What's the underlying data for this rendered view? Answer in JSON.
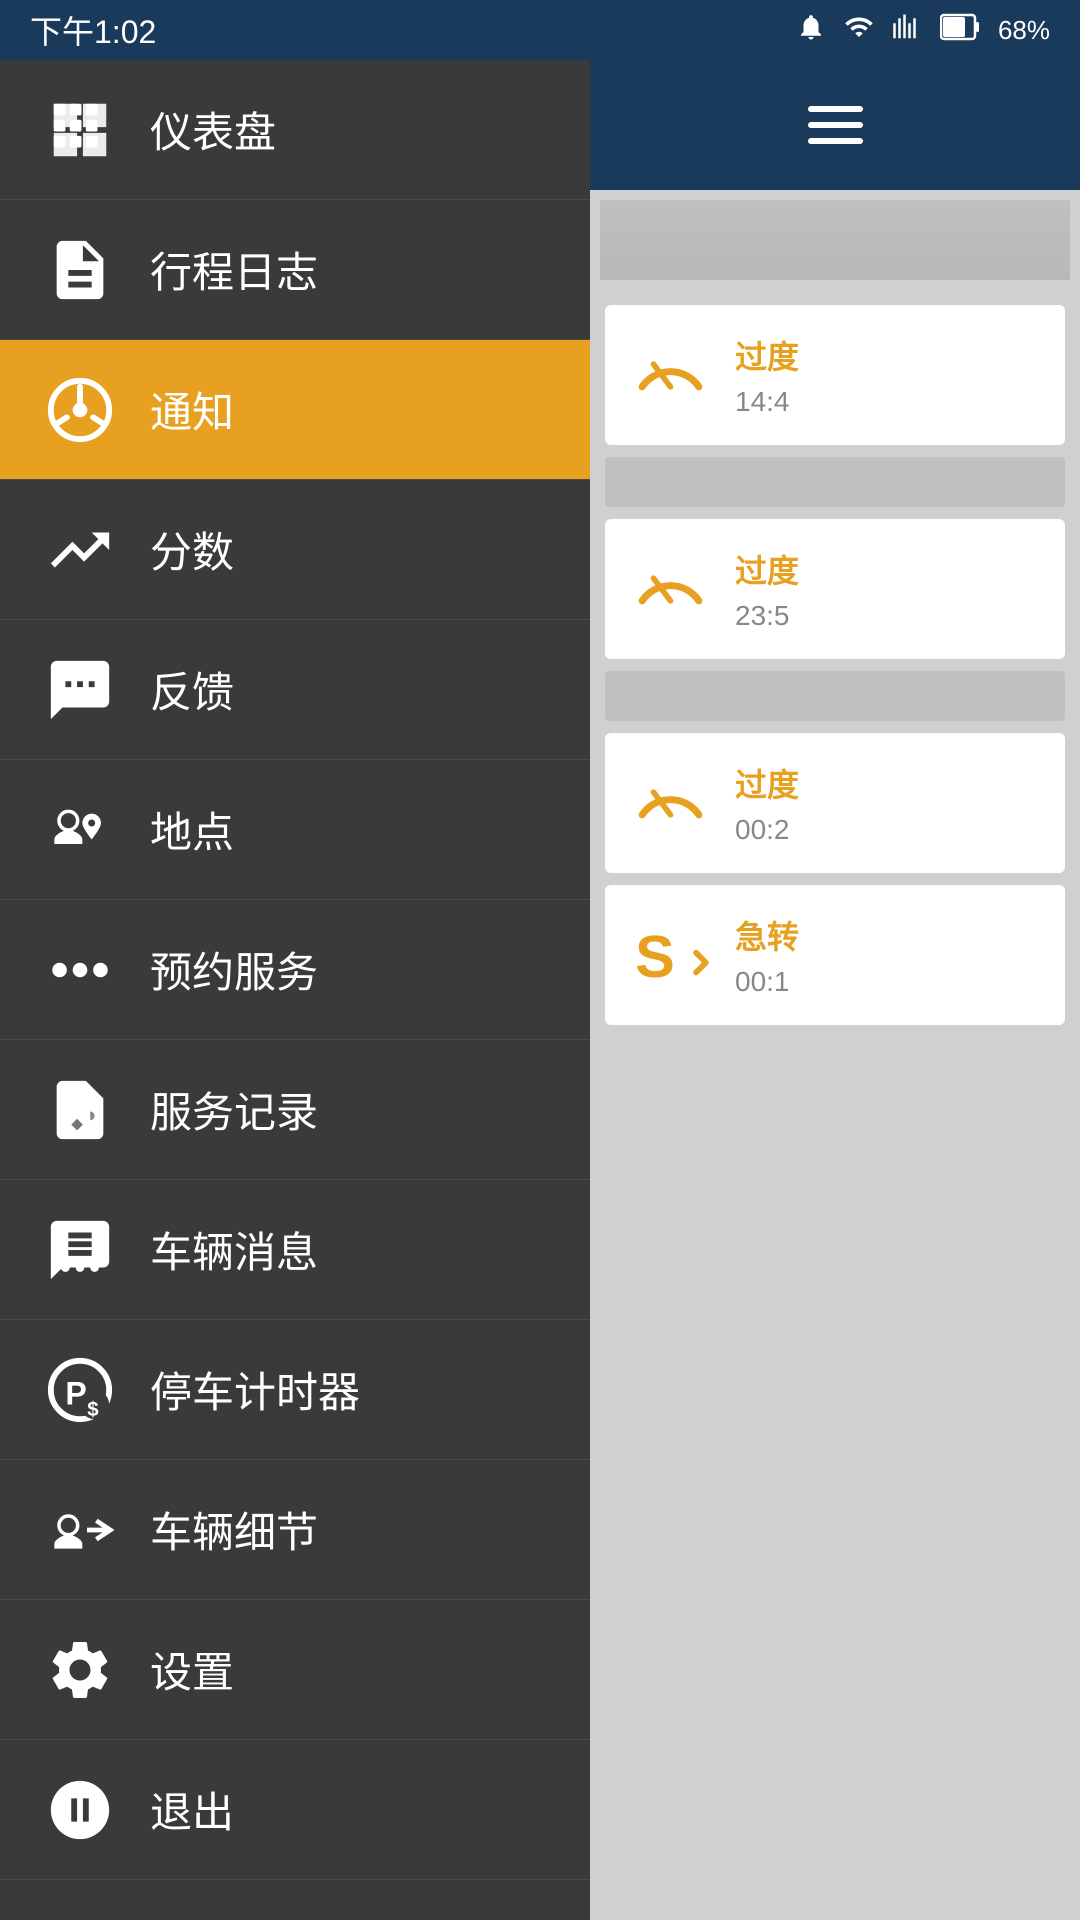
{
  "statusBar": {
    "time": "下午1:02",
    "battery": "68%"
  },
  "sidebar": {
    "items": [
      {
        "id": "dashboard",
        "label": "仪表盘",
        "icon": "dashboard",
        "active": false
      },
      {
        "id": "trip-log",
        "label": "行程日志",
        "icon": "trip-log",
        "active": false
      },
      {
        "id": "notifications",
        "label": "通知",
        "icon": "steering-wheel",
        "active": true
      },
      {
        "id": "scores",
        "label": "分数",
        "icon": "scores",
        "active": false
      },
      {
        "id": "feedback",
        "label": "反馈",
        "icon": "feedback",
        "active": false
      },
      {
        "id": "locations",
        "label": "地点",
        "icon": "locations",
        "active": false
      },
      {
        "id": "booking",
        "label": "预约服务",
        "icon": "booking",
        "active": false
      },
      {
        "id": "service-records",
        "label": "服务记录",
        "icon": "service-records",
        "active": false
      },
      {
        "id": "vehicle-messages",
        "label": "车辆消息",
        "icon": "vehicle-messages",
        "active": false
      },
      {
        "id": "parking-timer",
        "label": "停车计时器",
        "icon": "parking-timer",
        "active": false
      },
      {
        "id": "vehicle-details",
        "label": "车辆细节",
        "icon": "vehicle-details",
        "active": false
      },
      {
        "id": "settings",
        "label": "设置",
        "icon": "settings",
        "active": false
      },
      {
        "id": "logout",
        "label": "退出",
        "icon": "logout",
        "active": false
      }
    ]
  },
  "rightPanel": {
    "notifications": [
      {
        "id": 1,
        "type": "speeding",
        "title": "过度",
        "time": "14:4",
        "icon": "speedometer"
      },
      {
        "id": 2,
        "type": "speeding",
        "title": "过度",
        "time": "23:5",
        "icon": "speedometer"
      },
      {
        "id": 3,
        "type": "speeding",
        "title": "过度",
        "time": "00:2",
        "icon": "speedometer"
      },
      {
        "id": 4,
        "type": "sharp-turn",
        "title": "急转",
        "time": "00:1",
        "icon": "sharp-turn"
      }
    ],
    "accentColor": "#e8a020"
  }
}
